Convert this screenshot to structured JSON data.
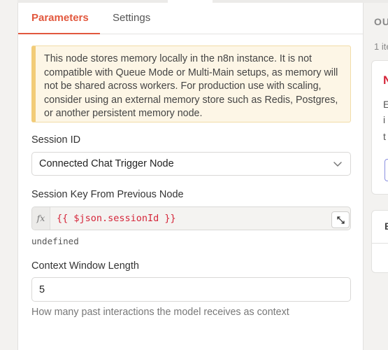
{
  "tabs": [
    {
      "label": "Parameters",
      "active": true
    },
    {
      "label": "Settings",
      "active": false
    }
  ],
  "notice": {
    "text": "This node stores memory locally in the n8n instance. It is not compatible with Queue Mode or Multi-Main setups, as memory will not be shared across workers. For production use with scaling, consider using an external memory store such as Redis, Postgres, or another persistent memory node."
  },
  "session_id": {
    "label": "Session ID",
    "value": "Connected Chat Trigger Node"
  },
  "session_key": {
    "label": "Session Key From Previous Node",
    "fx_label": "fx",
    "expression": "{{ $json.sessionId }}",
    "result": "undefined"
  },
  "context_window": {
    "label": "Context Window Length",
    "value": "5",
    "hint": "How many past interactions the model receives as context"
  },
  "right_panel": {
    "heading": "OU",
    "items": "1 ite",
    "card_initial": "N",
    "line1": "E",
    "line2": "i",
    "line3": "t",
    "card2_initial": "E"
  },
  "colors": {
    "accent": "#e2583e",
    "expression_text": "#d5263a",
    "notice_bg": "#fdf6e6",
    "notice_border": "#f2cc78"
  }
}
